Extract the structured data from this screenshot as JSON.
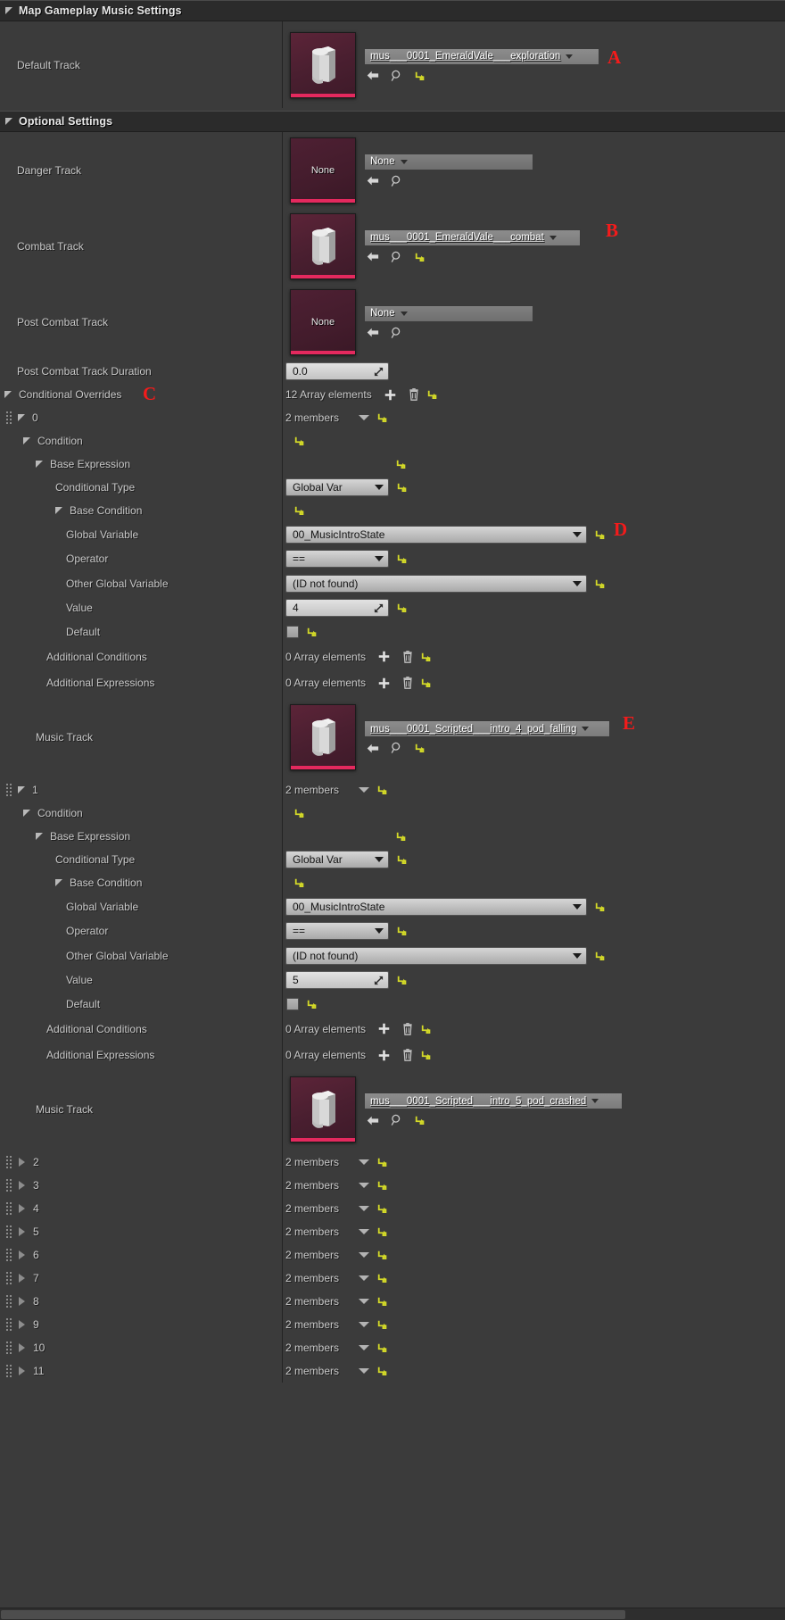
{
  "categories": {
    "main": "Map Gameplay Music Settings",
    "optional": "Optional Settings"
  },
  "labels": {
    "default_track": "Default Track",
    "danger_track": "Danger Track",
    "combat_track": "Combat Track",
    "post_combat_track": "Post Combat Track",
    "post_combat_duration": "Post Combat Track Duration",
    "conditional_overrides": "Conditional Overrides",
    "condition": "Condition",
    "base_expression": "Base Expression",
    "conditional_type": "Conditional Type",
    "base_condition": "Base Condition",
    "global_variable": "Global Variable",
    "operator": "Operator",
    "other_global_variable": "Other Global Variable",
    "value": "Value",
    "default": "Default",
    "additional_conditions": "Additional Conditions",
    "additional_expressions": "Additional Expressions",
    "music_track": "Music Track"
  },
  "values": {
    "default_track_asset": "mus___0001_EmeraldVale___exploration",
    "danger_track_asset": "None",
    "danger_thumb_label": "None",
    "combat_track_asset": "mus___0001_EmeraldVale___combat",
    "post_combat_track_asset": "None",
    "post_combat_thumb_label": "None",
    "post_combat_duration": "0.0",
    "conditional_overrides_count": "12 Array elements",
    "members_2": "2 members",
    "array_zero": "0 Array elements",
    "conditional_type_0": "Global Var",
    "global_variable_0": "00_MusicIntroState",
    "operator_0": "==",
    "other_global_variable_0": "(ID not found)",
    "value_0": "4",
    "music_track_0": "mus___0001_Scripted___intro_4_pod_falling",
    "conditional_type_1": "Global Var",
    "global_variable_1": "00_MusicIntroState",
    "operator_1": "==",
    "other_global_variable_1": "(ID not found)",
    "value_1": "5",
    "music_track_1": "mus___0001_Scripted___intro_5_pod_crashed"
  },
  "array_items": {
    "index_0": "0",
    "index_1": "1",
    "collapsed": [
      {
        "index": "2",
        "members": "2 members"
      },
      {
        "index": "3",
        "members": "2 members"
      },
      {
        "index": "4",
        "members": "2 members"
      },
      {
        "index": "5",
        "members": "2 members"
      },
      {
        "index": "6",
        "members": "2 members"
      },
      {
        "index": "7",
        "members": "2 members"
      },
      {
        "index": "8",
        "members": "2 members"
      },
      {
        "index": "9",
        "members": "2 members"
      },
      {
        "index": "10",
        "members": "2 members"
      },
      {
        "index": "11",
        "members": "2 members"
      }
    ]
  },
  "annotations": {
    "a": "A",
    "b": "B",
    "c": "C",
    "d": "D",
    "e": "E"
  },
  "icons": {
    "browse": "browse-to-asset-icon",
    "search": "search-asset-icon",
    "reset": "reset-to-default-icon",
    "add": "add-element-icon",
    "delete": "delete-element-icon"
  },
  "colors": {
    "accent_pink": "#e4295e",
    "reset_yellow": "#d7dd2a",
    "annotation_red": "#f31b1b",
    "panel_bg": "#3b3b3b",
    "header_bg": "#2b2b2b"
  }
}
